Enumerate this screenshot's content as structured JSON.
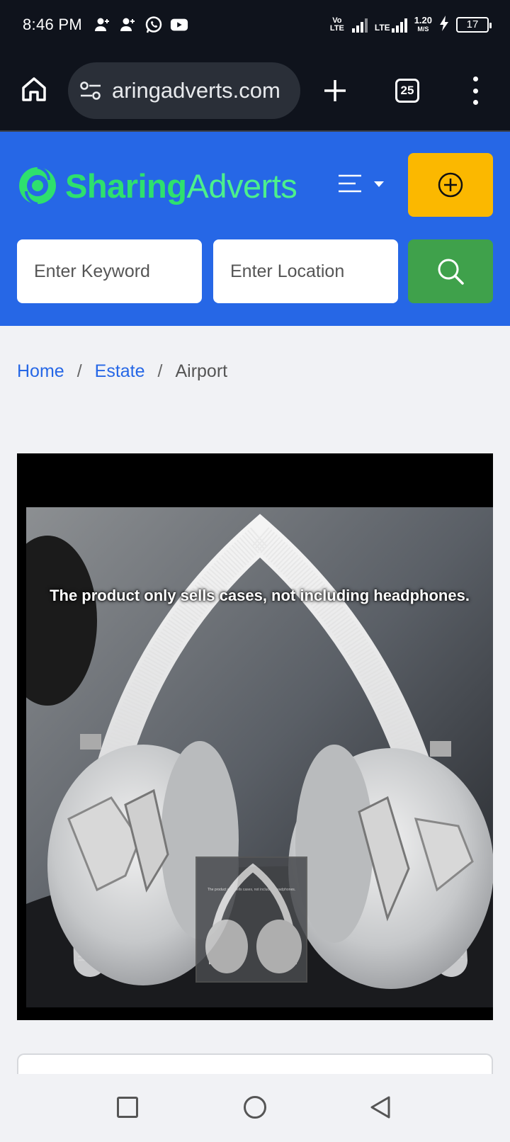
{
  "status_bar": {
    "time": "8:46 PM",
    "net_speed_value": "1.20",
    "net_speed_unit": "M/S",
    "battery": "17",
    "volte": "Vo\nLTE",
    "lte": "LTE"
  },
  "browser": {
    "url": "aringadverts.com",
    "tab_count": "25"
  },
  "header": {
    "logo_part1": "Sharing",
    "logo_part2": "Adverts",
    "brand_green": "#2ee06e",
    "header_blue": "#2667e6",
    "post_button_color": "#fbb800",
    "search_button_color": "#3fa14b"
  },
  "search": {
    "keyword_placeholder": "Enter Keyword",
    "location_placeholder": "Enter Location"
  },
  "breadcrumb": {
    "home": "Home",
    "separator": "/",
    "category": "Estate",
    "current": "Airport"
  },
  "media": {
    "caption": "The product only sells cases, not including headphones.",
    "thumb_caption": "The product only sells cases, not including headphones."
  }
}
